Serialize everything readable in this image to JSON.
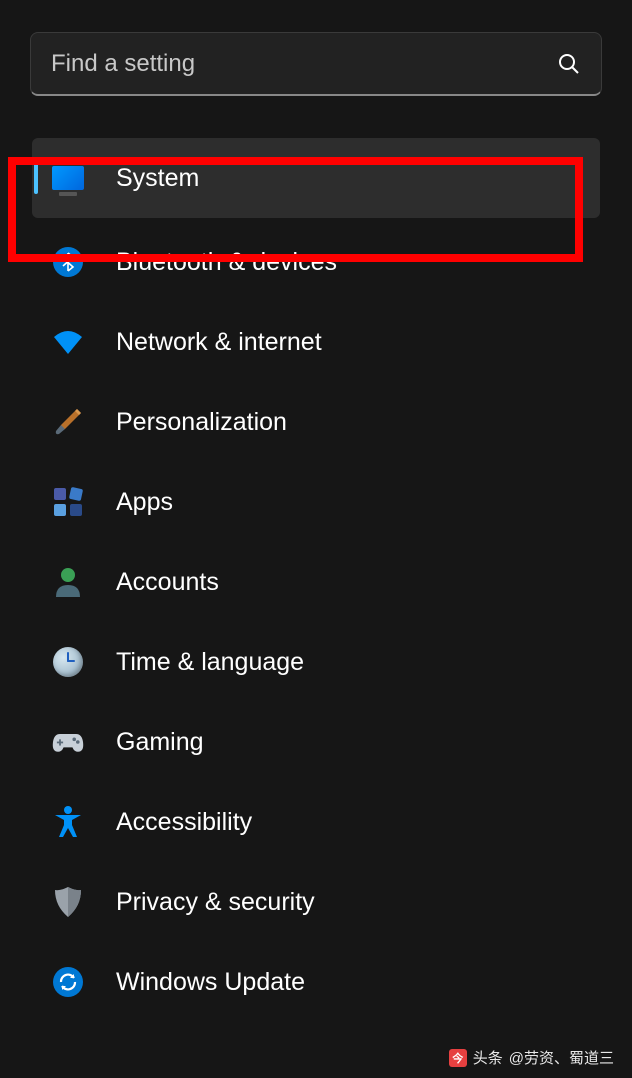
{
  "search": {
    "placeholder": "Find a setting"
  },
  "nav": {
    "items": [
      {
        "label": "System",
        "icon": "monitor-icon",
        "selected": true
      },
      {
        "label": "Bluetooth & devices",
        "icon": "bluetooth-icon",
        "selected": false
      },
      {
        "label": "Network & internet",
        "icon": "wifi-icon",
        "selected": false
      },
      {
        "label": "Personalization",
        "icon": "brush-icon",
        "selected": false
      },
      {
        "label": "Apps",
        "icon": "apps-icon",
        "selected": false
      },
      {
        "label": "Accounts",
        "icon": "person-icon",
        "selected": false
      },
      {
        "label": "Time & language",
        "icon": "clock-icon",
        "selected": false
      },
      {
        "label": "Gaming",
        "icon": "gamepad-icon",
        "selected": false
      },
      {
        "label": "Accessibility",
        "icon": "access-icon",
        "selected": false
      },
      {
        "label": "Privacy & security",
        "icon": "shield-icon",
        "selected": false
      },
      {
        "label": "Windows Update",
        "icon": "update-icon",
        "selected": false
      }
    ]
  },
  "watermark": {
    "prefix": "头条",
    "text": "@劳资、蜀道三"
  }
}
